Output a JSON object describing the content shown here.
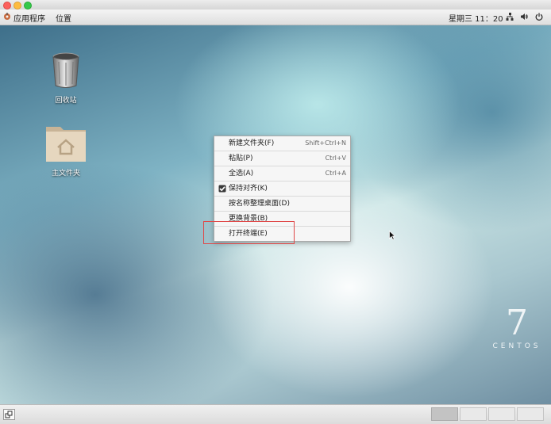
{
  "window": {
    "buttons": [
      "close",
      "minimize",
      "zoom"
    ]
  },
  "top_panel": {
    "applications": "应用程序",
    "places": "位置",
    "clock": "星期三 11：20",
    "tray_icons": [
      "network-icon",
      "volume-icon",
      "power-icon"
    ]
  },
  "desktop": {
    "icons": [
      {
        "label": "回收站",
        "icon": "trash-icon"
      },
      {
        "label": "主文件夹",
        "icon": "home-folder-icon"
      }
    ],
    "branding": {
      "number": "7",
      "word": "CENTOS"
    }
  },
  "context_menu": {
    "items": [
      {
        "label": "新建文件夹(F)",
        "accel": "Shift+Ctrl+N"
      },
      {
        "label": "粘贴(P)",
        "accel": "Ctrl+V"
      },
      {
        "label": "全选(A)",
        "accel": "Ctrl+A"
      },
      {
        "label": "保持对齐(K)",
        "accel": "",
        "checked": true
      },
      {
        "label": "按名称整理桌面(D)",
        "accel": ""
      },
      {
        "label": "更换背景(B)",
        "accel": ""
      },
      {
        "label": "打开终端(E)",
        "accel": "",
        "highlighted": true
      }
    ]
  },
  "bottom_panel": {
    "workspaces": 4,
    "active_workspace": 1
  },
  "colors": {
    "highlight_box": "#e04848"
  }
}
